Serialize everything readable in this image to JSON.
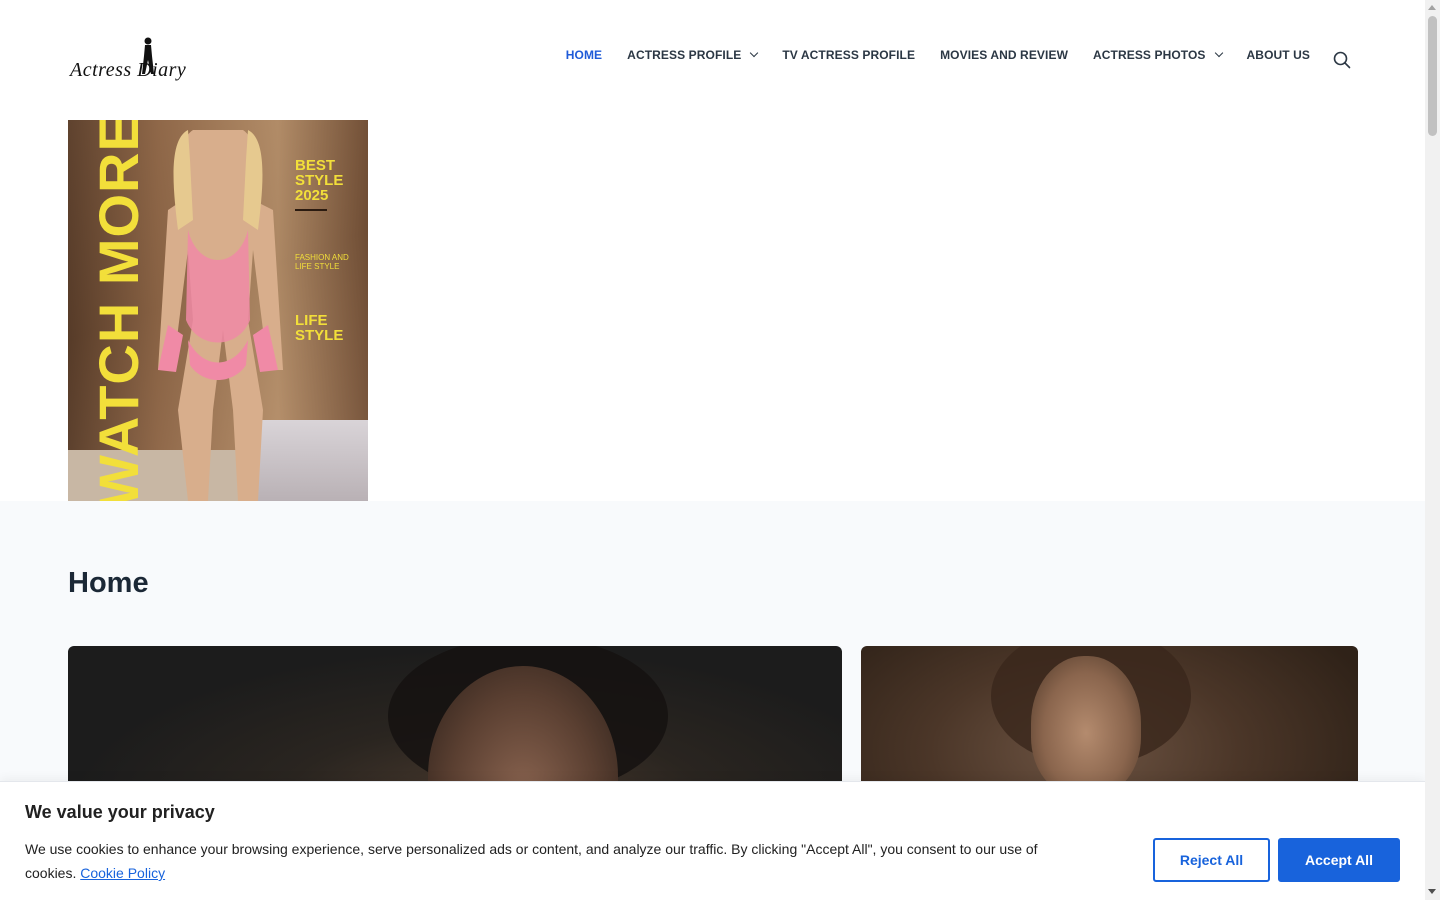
{
  "site": {
    "logo_text": "Actress Diary"
  },
  "nav": {
    "items": [
      {
        "label": "HOME",
        "active": true,
        "dropdown": false
      },
      {
        "label": "ACTRESS PROFILE",
        "active": false,
        "dropdown": true
      },
      {
        "label": "TV ACTRESS PROFILE",
        "active": false,
        "dropdown": false
      },
      {
        "label": "MOVIES AND REVIEW",
        "active": false,
        "dropdown": false
      },
      {
        "label": "ACTRESS PHOTOS",
        "active": false,
        "dropdown": true
      },
      {
        "label": "ABOUT US",
        "active": false,
        "dropdown": false
      }
    ],
    "search_icon": "search-icon",
    "active_color": "#1f5bd8"
  },
  "hero": {
    "watch_more": "WATCH MORE",
    "best_style": "BEST STYLE 2025",
    "fashion": "FASHION AND LIFE STYLE",
    "life_style": "LIFE STYLE",
    "accent_color": "#f2df3a"
  },
  "main": {
    "page_title": "Home"
  },
  "cookie": {
    "title": "We value your privacy",
    "text": "We use cookies to enhance your browsing experience, serve personalized ads or content, and analyze our traffic. By clicking \"Accept All\", you consent to our use of cookies.",
    "policy_link": "Cookie Policy",
    "reject_label": "Reject All",
    "accept_label": "Accept All",
    "accent_color": "#1863dc"
  }
}
